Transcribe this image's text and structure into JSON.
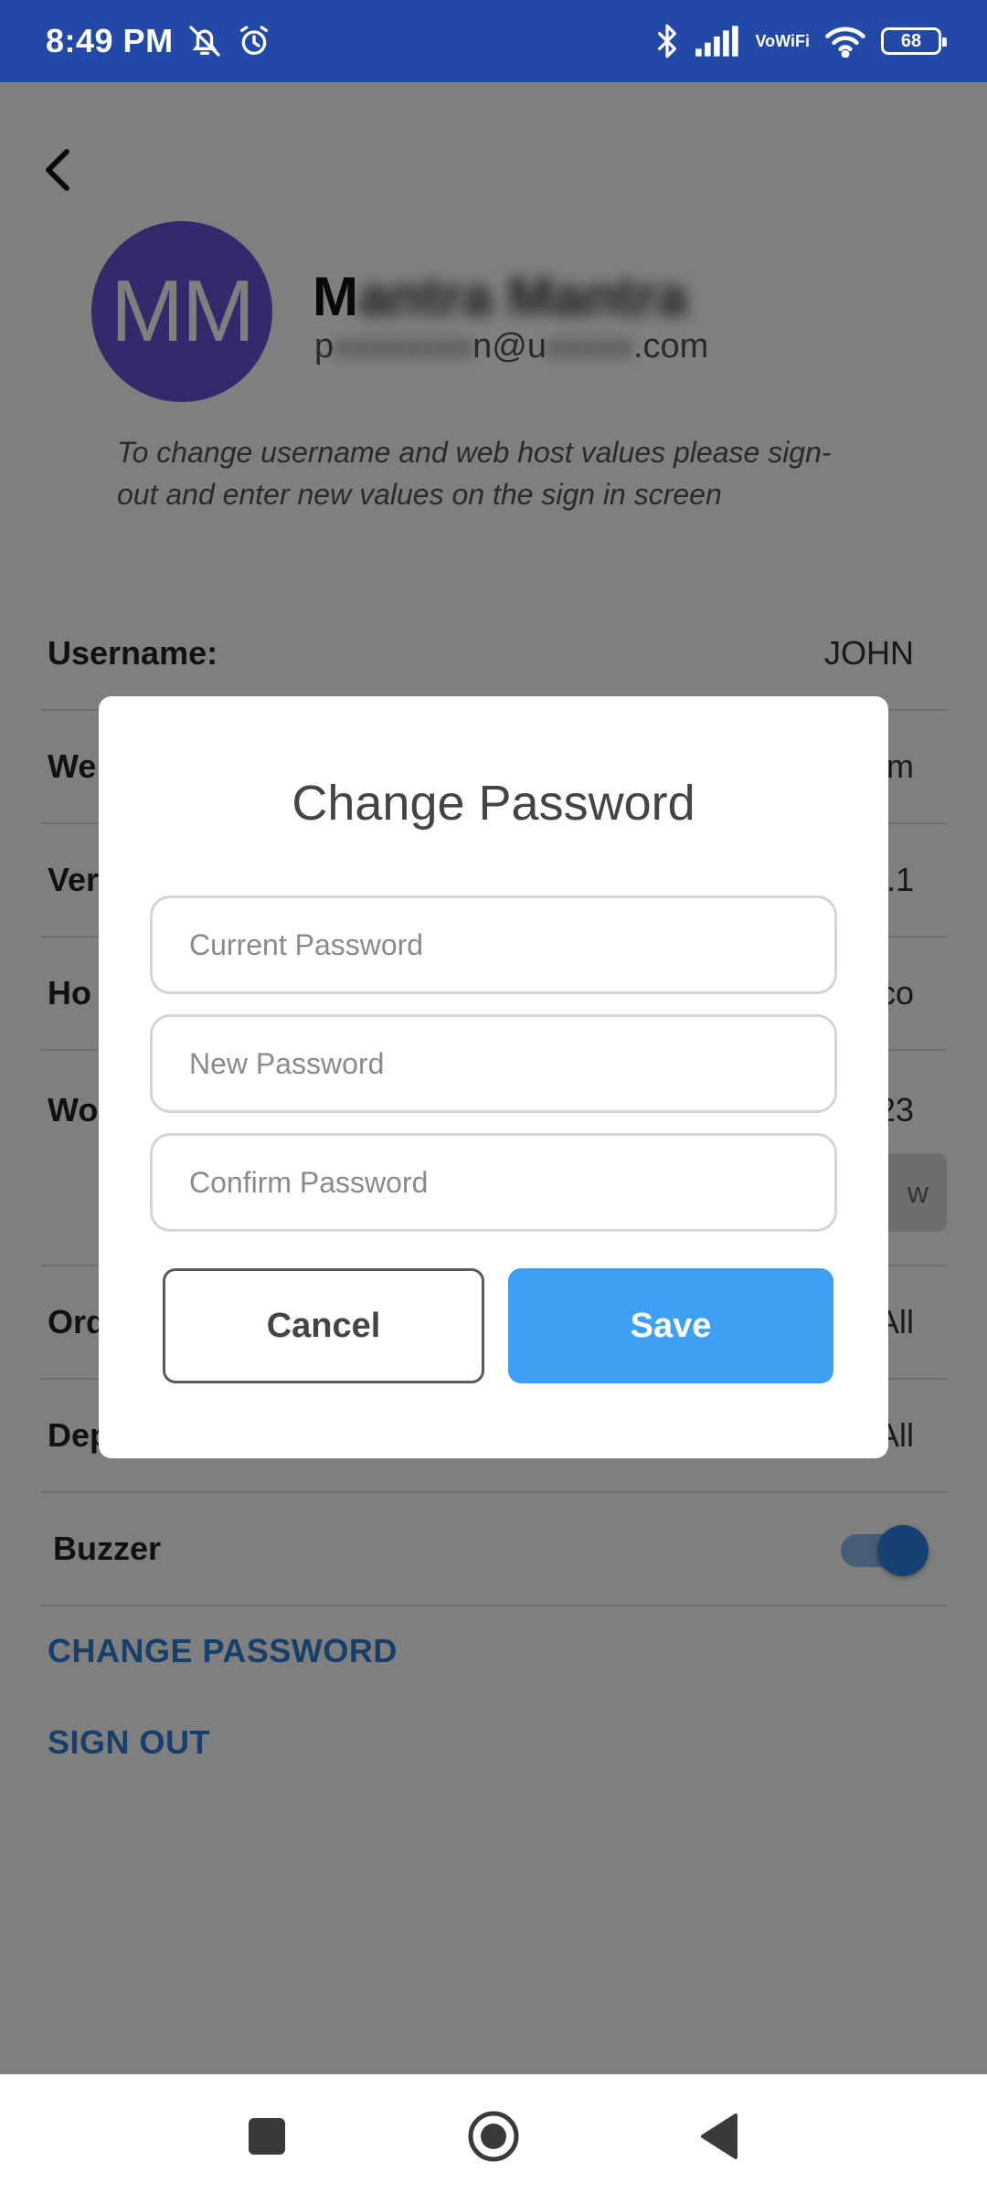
{
  "status_bar": {
    "time": "8:49 PM",
    "vowifi_top": "Vo",
    "vowifi_bottom": "WiFi",
    "battery": "68",
    "icons": [
      "muted-bell-icon",
      "alarm-icon",
      "bluetooth-icon",
      "signal-icon",
      "vowifi-icon",
      "wifi-icon",
      "battery-icon"
    ]
  },
  "profile": {
    "initials": "MM",
    "name_visible": "M",
    "name_obscured": "antra Mantra",
    "email_prefix": "p",
    "email_obscured_1": "xxxxxxxx",
    "email_mid": "n@u",
    "email_obscured_2": "xxxxx",
    "email_suffix": ".com",
    "avatar_color": "#6a52d6"
  },
  "info_note": "To change username and web host values please sign-out and enter new values on the sign in screen",
  "settings": {
    "username": {
      "label": "Username:",
      "value": "JOHN"
    },
    "web_host": {
      "label": "We",
      "value": "m"
    },
    "version": {
      "label": "Ver",
      "value": ".1"
    },
    "host": {
      "label": "Ho",
      "value": "co"
    },
    "work": {
      "label": "Wo",
      "value": "23",
      "button": "w"
    },
    "orders": {
      "label": "Ord",
      "value": "All"
    },
    "departments": {
      "label": "Dep",
      "value": "All"
    },
    "buzzer": {
      "label": "Buzzer",
      "enabled": true
    }
  },
  "links": {
    "change_password": "CHANGE PASSWORD",
    "sign_out": "SIGN OUT"
  },
  "dialog": {
    "title": "Change Password",
    "current_placeholder": "Current Password",
    "new_placeholder": "New Password",
    "confirm_placeholder": "Confirm Password",
    "cancel_label": "Cancel",
    "save_label": "Save"
  },
  "colors": {
    "status_bar": "#2249a8",
    "accent": "#2f7fd6",
    "save_button": "#3ea0f5",
    "toggle_on": "#2f80e6"
  }
}
